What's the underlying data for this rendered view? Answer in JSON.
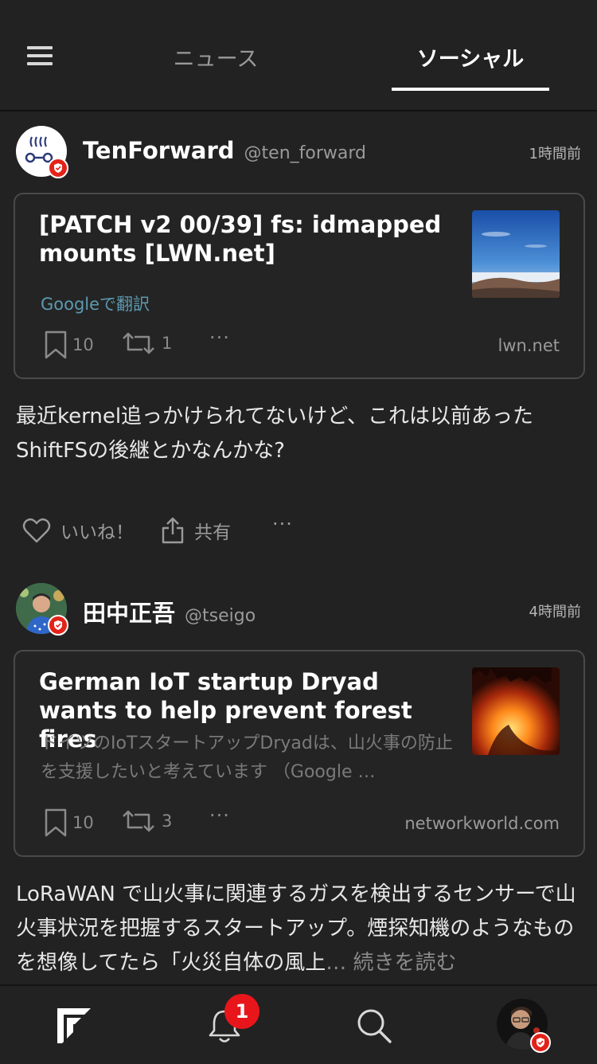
{
  "header": {
    "tabs": [
      {
        "label": "ニュース",
        "active": false
      },
      {
        "label": "ソーシャル",
        "active": true
      }
    ]
  },
  "posts": [
    {
      "author": "TenForward",
      "handle": "@ten_forward",
      "time": "1時間前",
      "card": {
        "title": "[PATCH v2 00/39] fs: idmapped mounts [LWN.net]",
        "translate": "Googleで翻訳",
        "bookmarks": "10",
        "reposts": "1",
        "more": "···",
        "domain": "lwn.net"
      },
      "text": "最近kernel追っかけられてないけど、これは以前あったShiftFSの後継とかなんかな?",
      "actions": {
        "like": "いいね！",
        "share": "共有",
        "more": "···"
      }
    },
    {
      "author": "田中正吾",
      "handle": "@tseigo",
      "time": "4時間前",
      "card": {
        "title": "German IoT startup Dryad wants to help prevent forest fires",
        "excerpt": "ドイツのIoTスタートアップDryadは、山火事の防止を支援したいと考えています （Google …",
        "bookmarks": "10",
        "reposts": "3",
        "more": "···",
        "domain": "networkworld.com"
      },
      "text": "LoRaWAN で山火事に関連するガスを検出するセンサーで山火事状況を把握するスタートアップ。煙探知機のようなものを想像してたら「火災自体の風上",
      "readmore": "… 続きを読む"
    }
  ],
  "bottom_nav": {
    "notification_count": "1"
  },
  "colors": {
    "background": "#222222",
    "card_border": "#4a4a4a",
    "link": "#5c9ab0",
    "badge_red": "#e32219"
  }
}
